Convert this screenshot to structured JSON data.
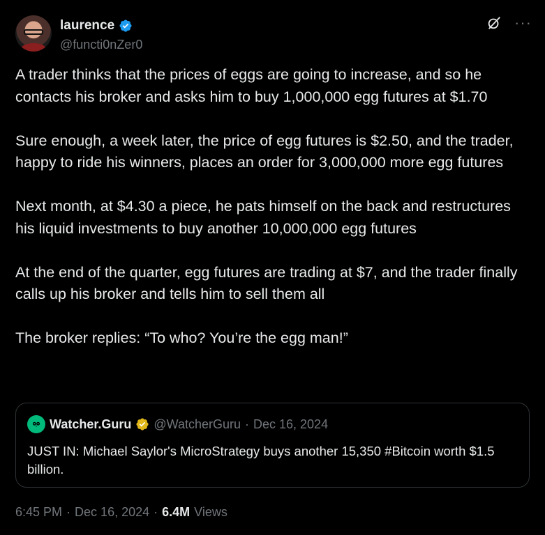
{
  "author": {
    "display_name": "laurence",
    "handle": "@functi0nZer0",
    "verified_icon": "blue-verified-badge"
  },
  "top_actions": {
    "grok_icon": "grok-icon",
    "more_label": "···"
  },
  "tweet": {
    "paragraphs": [
      "A trader thinks that the prices of eggs are going to increase, and so he contacts his broker and asks him to buy 1,000,000 egg futures at $1.70",
      "Sure enough, a week later, the price of egg futures is $2.50, and the trader, happy to ride his winners, places an order for 3,000,000 more egg futures",
      "Next month, at $4.30 a piece, he pats himself on the back and restructures his liquid investments to buy another 10,000,000 egg futures",
      "At the end of the quarter, egg futures are trading at $7, and the trader finally calls up his broker and tells him to sell them all",
      "The broker replies: “To who? You’re the egg man!”"
    ]
  },
  "quote": {
    "display_name": "Watcher.Guru",
    "handle": "@WatcherGuru",
    "separator": "·",
    "date": "Dec 16, 2024",
    "text": "JUST IN: Michael Saylor's MicroStrategy buys another 15,350 #Bitcoin worth $1.5 billion.",
    "badge_icon": "gold-verified-badge"
  },
  "meta": {
    "time": "6:45 PM",
    "sep1": "·",
    "date": "Dec 16, 2024",
    "sep2": "·",
    "views_count": "6.4M",
    "views_label": "Views"
  },
  "colors": {
    "background": "#000000",
    "text": "#e7e9ea",
    "muted": "#71767b",
    "verified_blue": "#1d9bf0",
    "verified_gold": "#e2b719",
    "border": "#2f3336"
  }
}
